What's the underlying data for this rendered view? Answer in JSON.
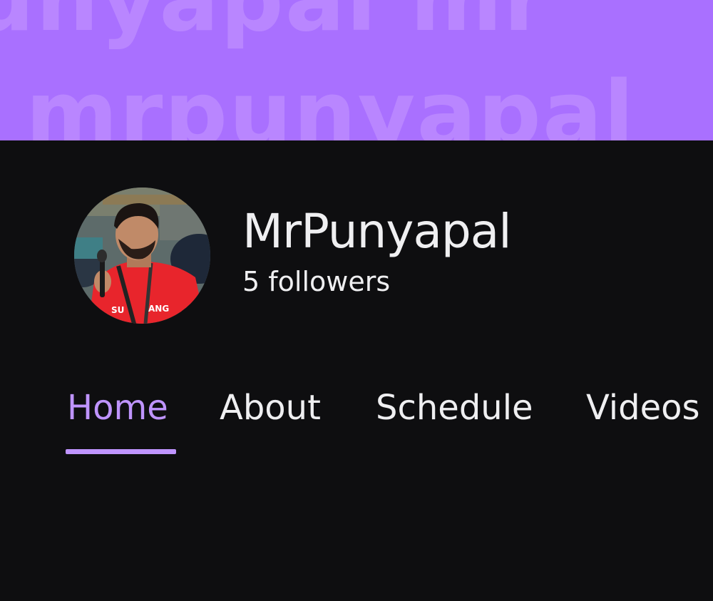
{
  "banner": {
    "text_line1": "unyapal mr",
    "text_line2": "mrpunyapal",
    "background_color": "#a970ff",
    "text_color": "#b986ff"
  },
  "profile": {
    "avatar_icon": "user-avatar-photo",
    "channel_name": "MrPunyapal",
    "followers": "5 followers"
  },
  "tabs": [
    {
      "label": "Home",
      "active": true
    },
    {
      "label": "About",
      "active": false
    },
    {
      "label": "Schedule",
      "active": false
    },
    {
      "label": "Videos",
      "active": false
    }
  ],
  "colors": {
    "page_background": "#0e0e10",
    "accent": "#bf94ff",
    "text": "#efeff1"
  }
}
